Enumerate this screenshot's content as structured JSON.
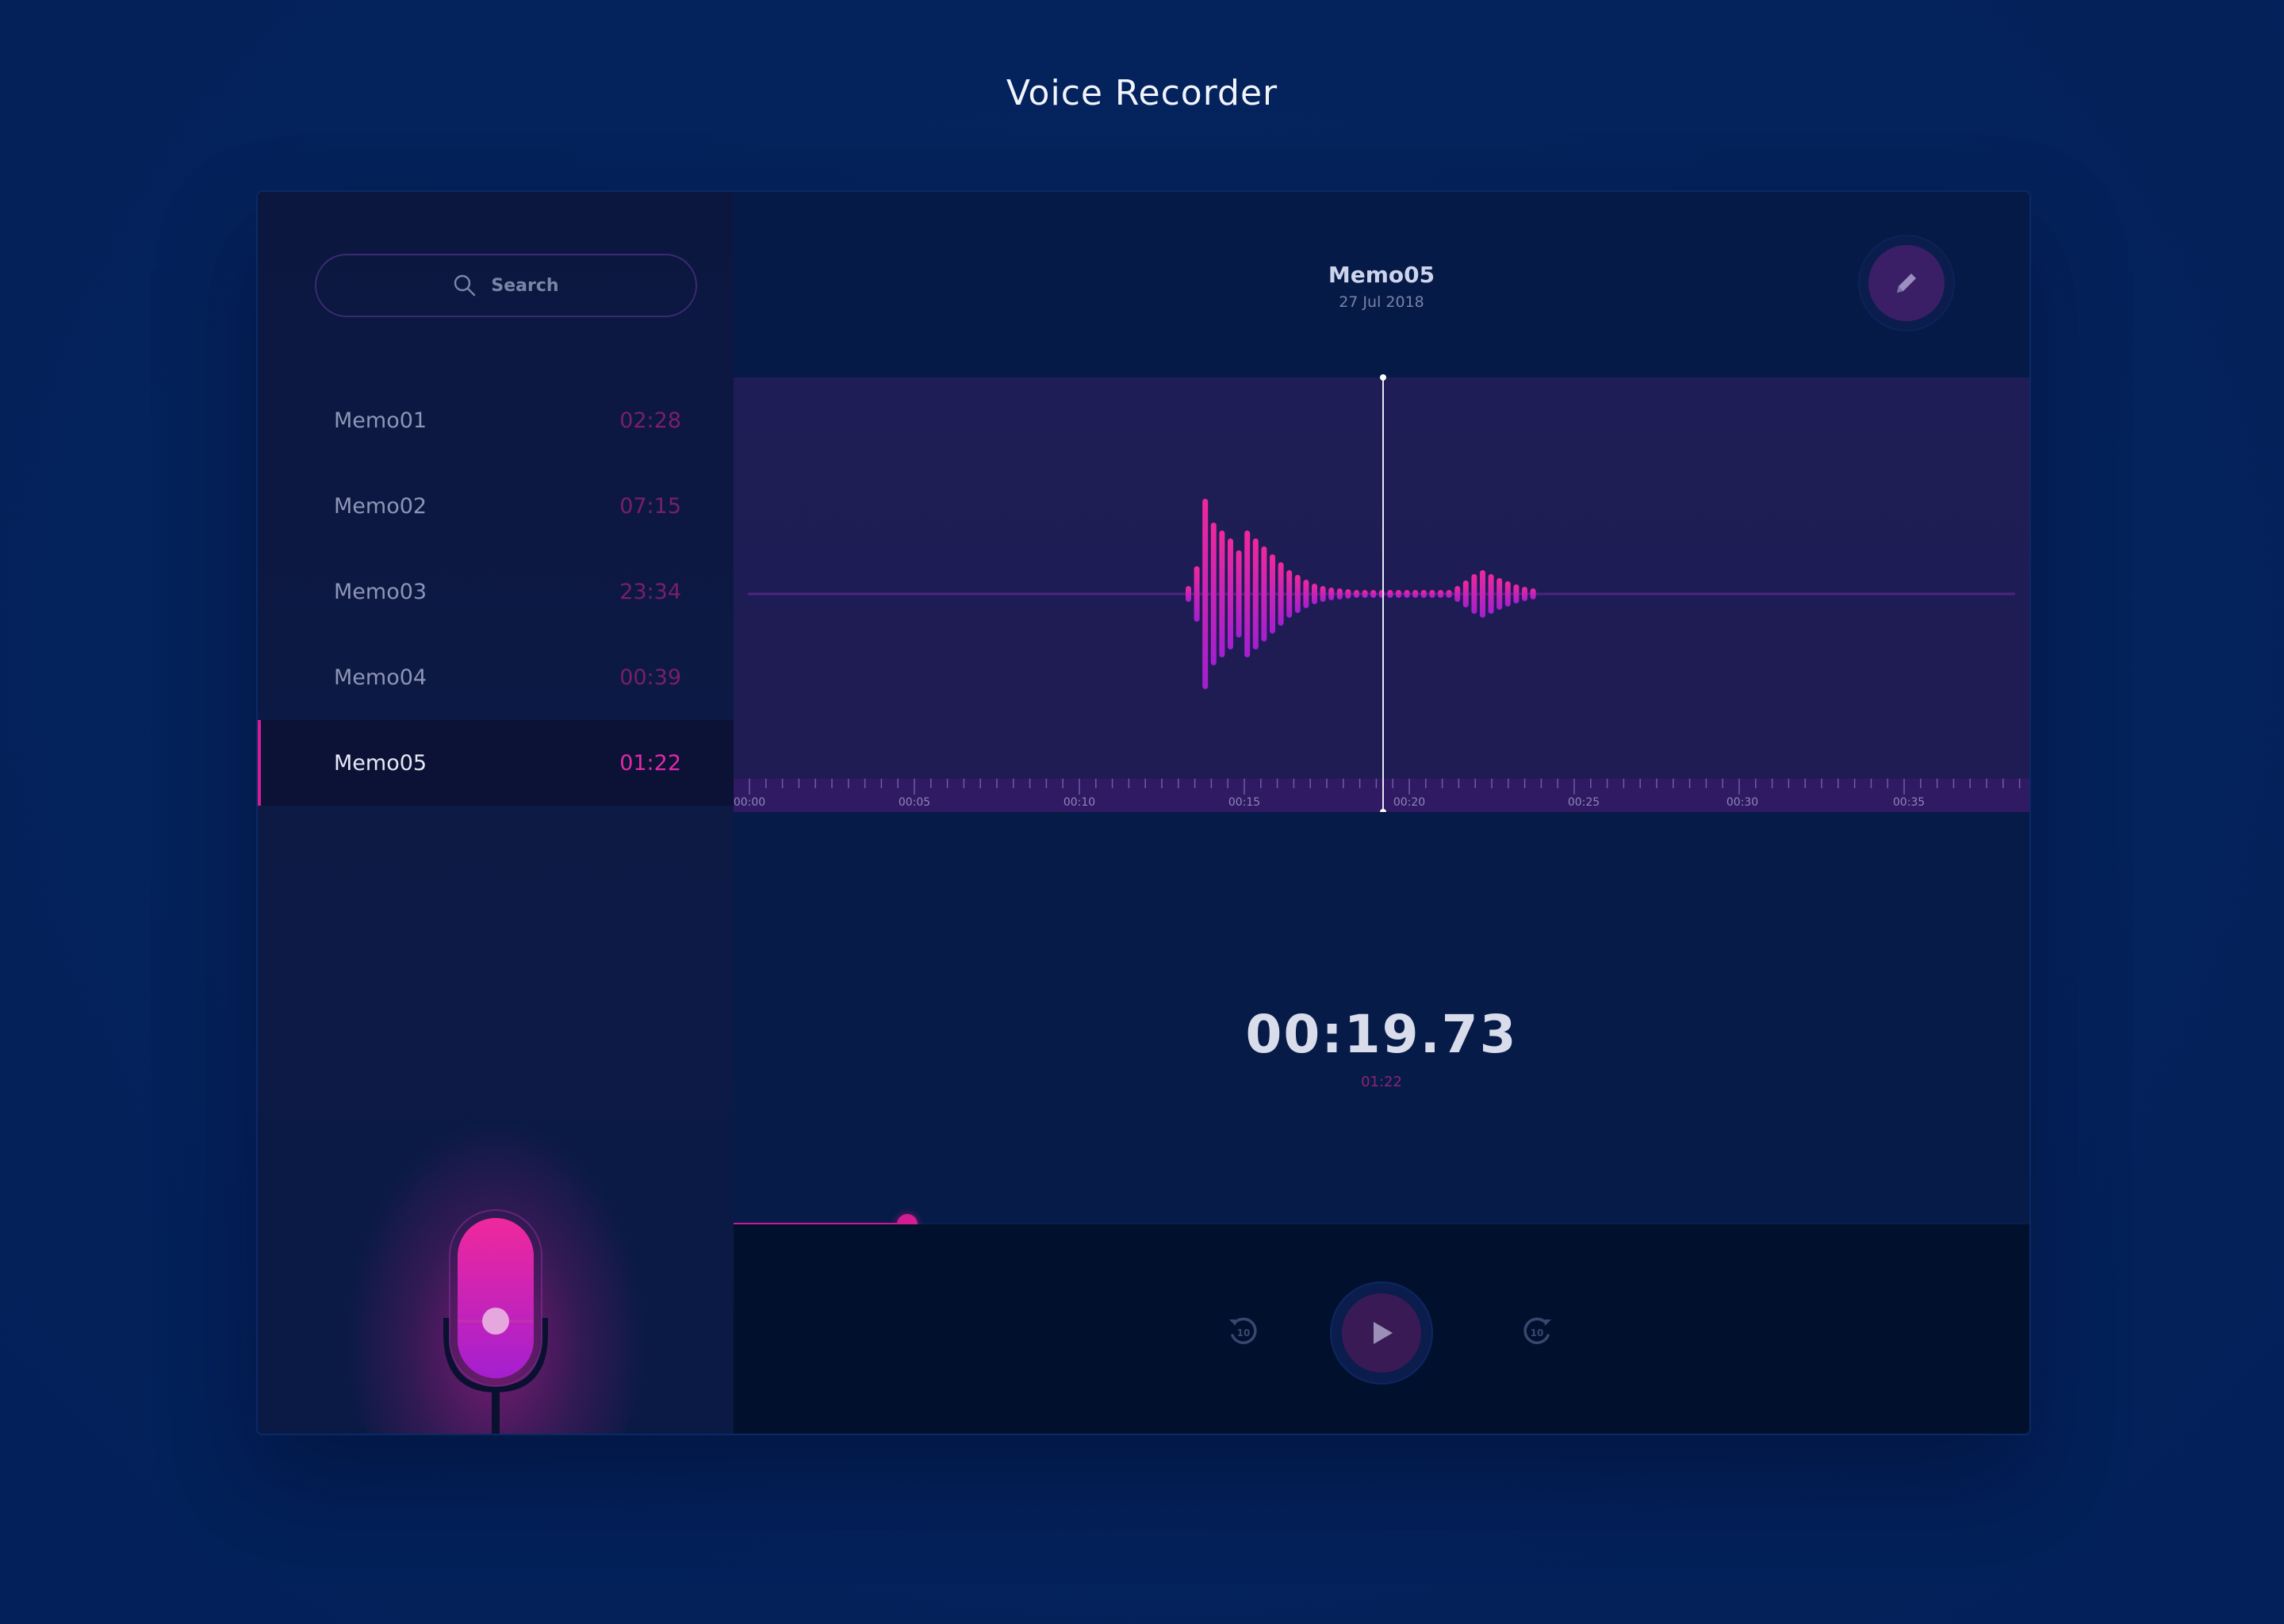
{
  "page": {
    "title": "Voice Recorder"
  },
  "search": {
    "placeholder": "Search",
    "icon": "search-icon"
  },
  "memos": [
    {
      "name": "Memo01",
      "duration": "02:28"
    },
    {
      "name": "Memo02",
      "duration": "07:15"
    },
    {
      "name": "Memo03",
      "duration": "23:34"
    },
    {
      "name": "Memo04",
      "duration": "00:39"
    },
    {
      "name": "Memo05",
      "duration": "01:22",
      "selected": true
    }
  ],
  "player": {
    "title": "Memo05",
    "date": "27 Jul 2018",
    "current_time": "00:19.73",
    "total_time": "01:22",
    "progress_fraction": 0.134,
    "edit_icon": "pencil-icon"
  },
  "timeline": {
    "labels": [
      "00:00",
      "00:05",
      "00:10",
      "00:15",
      "00:20",
      "00:25",
      "00:30",
      "00:35"
    ]
  },
  "controls": {
    "rewind_icon": "rewind-10-icon",
    "play_icon": "play-icon",
    "forward_icon": "forward-10-icon"
  },
  "colors": {
    "background": "#04225b",
    "accent_pink": "#e02aa6",
    "accent_purple": "#a21fd0",
    "panel": "#061a47",
    "waveform_bg": "#1e1d55"
  }
}
